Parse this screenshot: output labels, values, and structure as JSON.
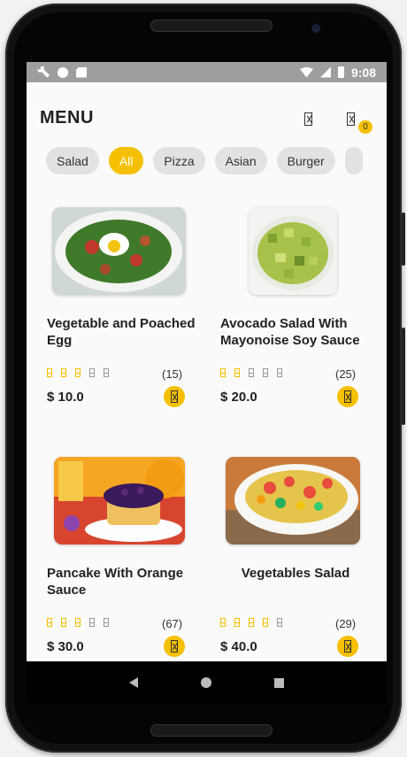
{
  "status": {
    "time": "9:08",
    "left_icons": [
      "wrench-icon",
      "circle-icon",
      "sd-card-icon"
    ],
    "right_icons": [
      "wifi-icon",
      "signal-icon",
      "battery-icon"
    ]
  },
  "header": {
    "title": "MENU",
    "cart_count": "0",
    "icons": [
      "search-icon",
      "cart-icon"
    ]
  },
  "categories": [
    "Salad",
    "All",
    "Pizza",
    "Asian",
    "Burger",
    ""
  ],
  "active_category": "All",
  "colors": {
    "accent": "#f5c000",
    "chip": "#e2e2e2",
    "background": "#fafafa"
  },
  "products": [
    {
      "name": "Vegetable and Poached Egg",
      "rating": 3,
      "reviews": "(15)",
      "price": "$ 10.0"
    },
    {
      "name": "Avocado Salad With Mayonoise Soy Sauce",
      "rating": 2,
      "reviews": "(25)",
      "price": "$ 20.0"
    },
    {
      "name": "Pancake With Orange Sauce",
      "rating": 3,
      "reviews": "(67)",
      "price": "$ 30.0"
    },
    {
      "name": "Vegetables Salad",
      "rating": 4,
      "reviews": "(29)",
      "price": "$ 40.0"
    }
  ],
  "navigation": [
    "back-icon",
    "home-icon",
    "recents-icon"
  ]
}
